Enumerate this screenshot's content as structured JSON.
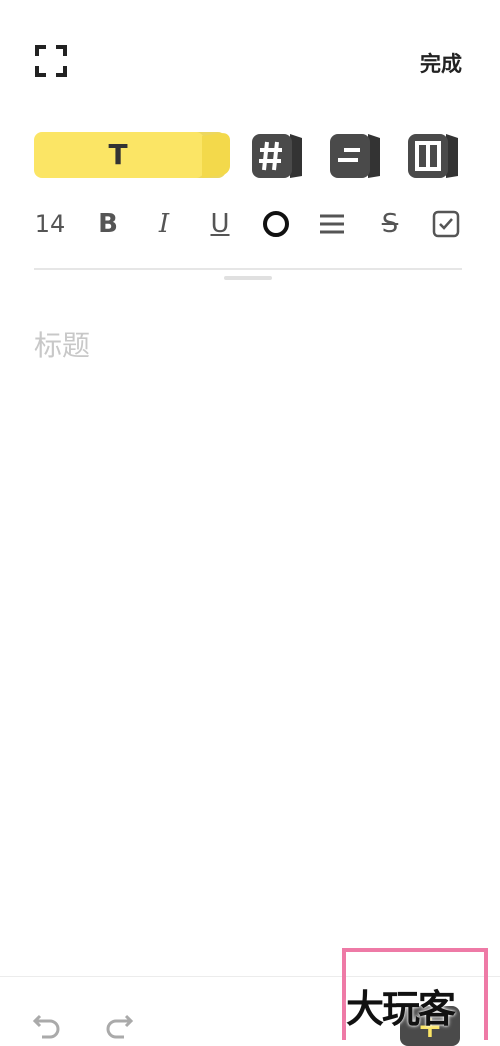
{
  "header": {
    "fullscreen_icon": "expand-corners-icon",
    "done_label": "完成"
  },
  "style_tiles": {
    "text_tile_label": "T",
    "tiles": [
      {
        "name": "text-style",
        "icon": "T",
        "color": "#fbe565",
        "selected": true
      },
      {
        "name": "tag-style",
        "icon": "hash-icon",
        "color": "#4a4a4a",
        "selected": false
      },
      {
        "name": "list-style",
        "icon": "lines-icon",
        "color": "#4a4a4a",
        "selected": false
      },
      {
        "name": "layout-style",
        "icon": "layout-icon",
        "color": "#4a4a4a",
        "selected": false
      }
    ]
  },
  "format_toolbar": {
    "font_size": "14",
    "bold": "B",
    "italic": "I",
    "underline": "U",
    "color_icon": "color-circle-icon",
    "align_icon": "align-lines-icon",
    "strike": "S",
    "checkbox_icon": "checkbox-icon"
  },
  "editor": {
    "title_placeholder": "标题"
  },
  "bottom_bar": {
    "undo_icon": "undo-icon",
    "redo_icon": "redo-icon",
    "add_label": "+",
    "watermark_text": "大玩客"
  },
  "colors": {
    "accent": "#fbe565",
    "dark_tile": "#4a4a4a",
    "watermark_border": "#ee7aa6"
  }
}
